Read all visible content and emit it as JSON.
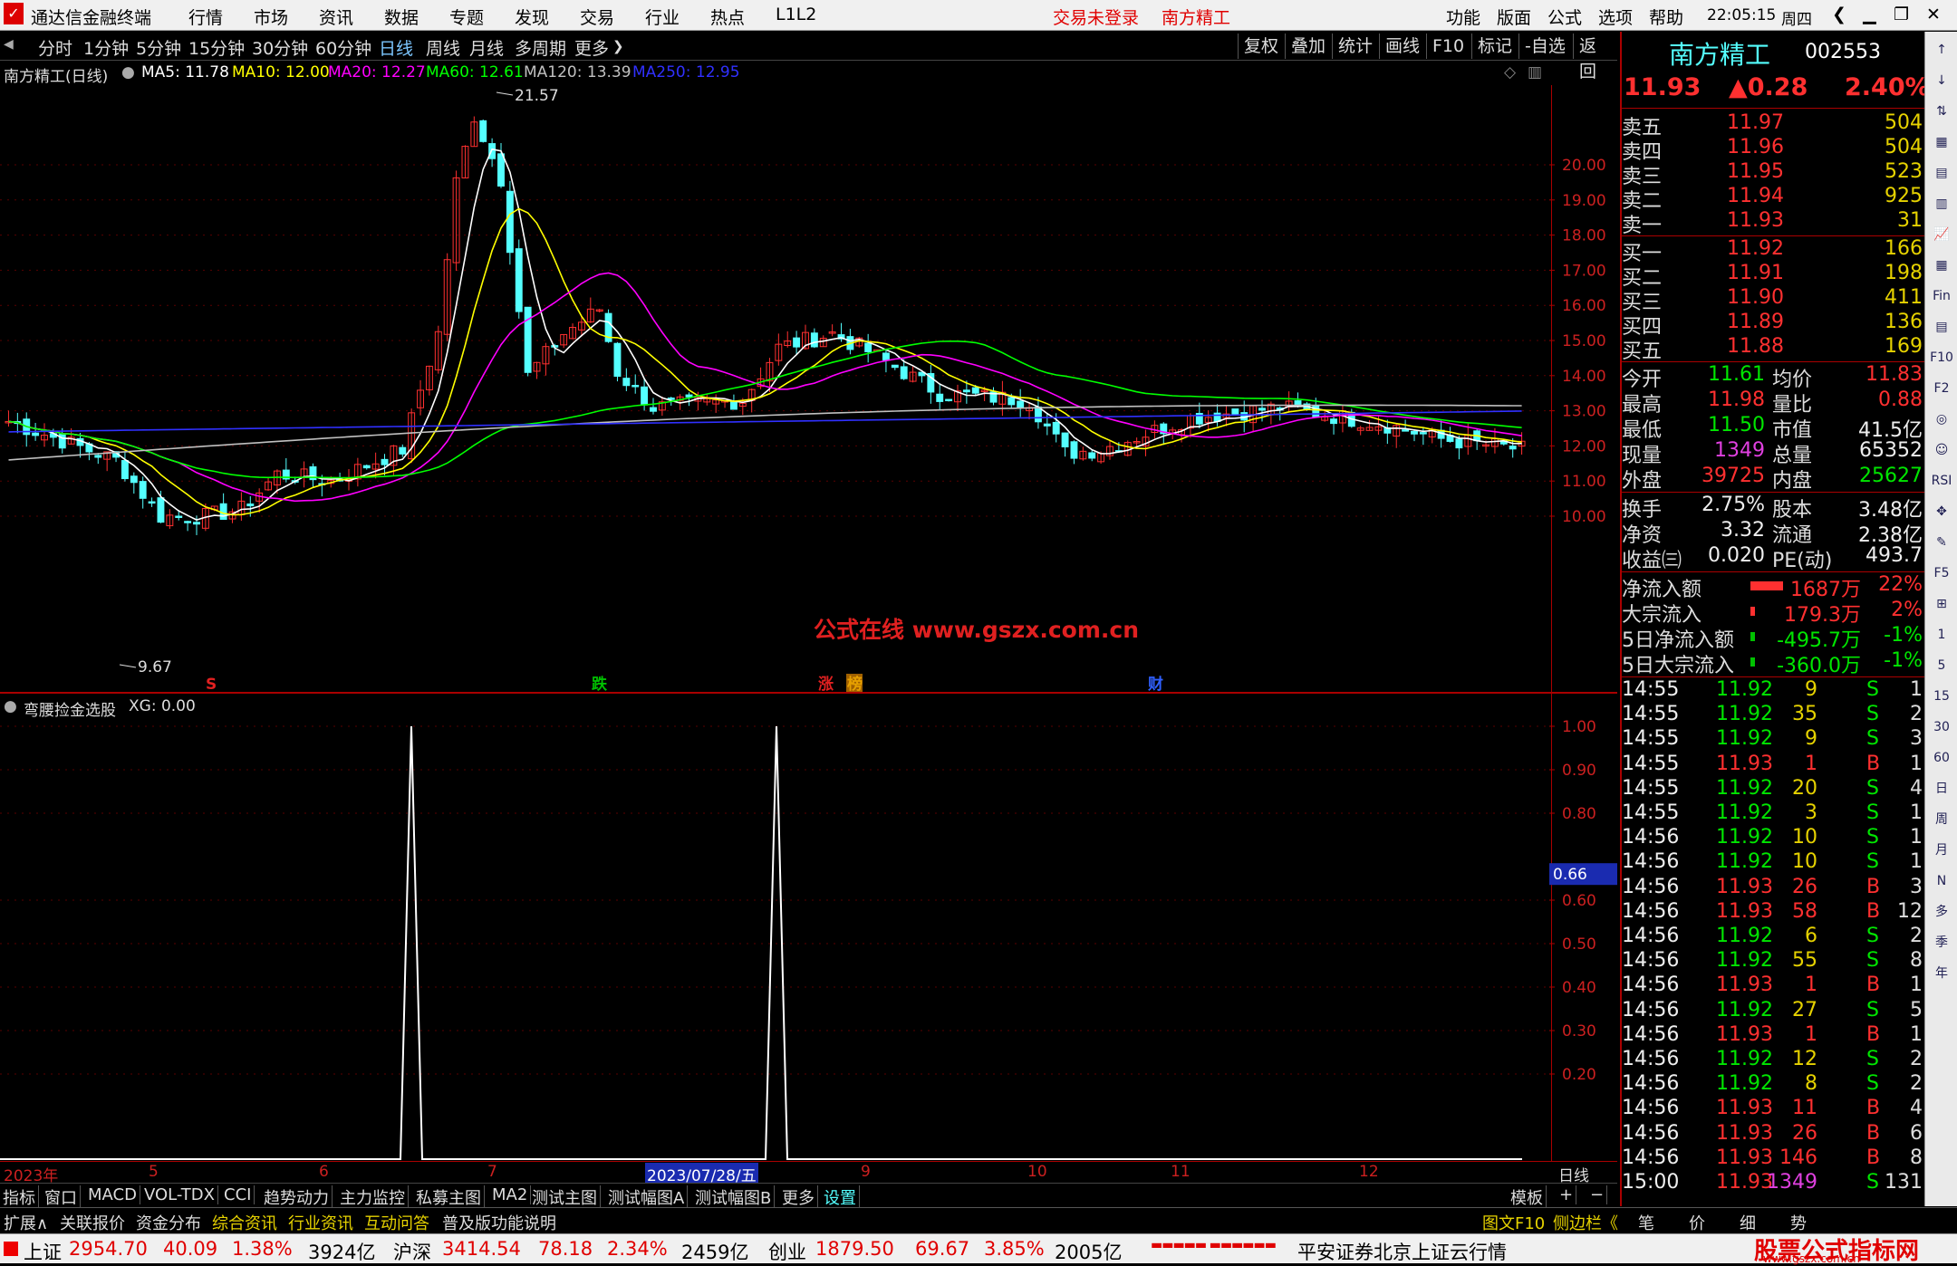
{
  "titlebar": {
    "app_name": "通达信金融终端",
    "menu": [
      "行情",
      "市场",
      "资讯",
      "数据",
      "专题",
      "发现",
      "交易",
      "行业",
      "热点",
      "L1L2"
    ],
    "status_login": "交易未登录",
    "stock_title": "南方精工",
    "right_menu": [
      "功能",
      "版面",
      "公式",
      "选项",
      "帮助"
    ],
    "clock": "22:05:15",
    "weekday": "周四"
  },
  "periods": [
    "分时",
    "1分钟",
    "5分钟",
    "15分钟",
    "30分钟",
    "60分钟",
    "日线",
    "周线",
    "月线",
    "多周期",
    "更多"
  ],
  "period_selected": "日线",
  "toolbar_right": [
    "复权",
    "叠加",
    "统计",
    "画线",
    "F10",
    "标记",
    "-自选",
    "返回"
  ],
  "chart_header": {
    "title": "南方精工(日线)",
    "ma5": "MA5: 11.78",
    "ma10": "MA10: 12.00",
    "ma20": "MA20: 12.27",
    "ma60": "MA60: 12.61",
    "ma120": "MA120: 13.39",
    "ma250": "MA250: 12.95"
  },
  "price_high_label": "21.57",
  "price_low_label": "9.67",
  "price_axis": [
    "20.00",
    "19.00",
    "18.00",
    "17.00",
    "16.00",
    "15.00",
    "14.00",
    "13.00",
    "12.00",
    "11.00",
    "10.00"
  ],
  "watermark": "公式在线  www.gszx.com.cn",
  "event_markers": [
    "S",
    "跌",
    "涨",
    "榜",
    "财"
  ],
  "indicator": {
    "title": "弯腰捡金选股",
    "value": "XG: 0.00",
    "axis": [
      "1.00",
      "0.90",
      "0.80",
      "0.66",
      "0.60",
      "0.50",
      "0.40",
      "0.30",
      "0.20"
    ],
    "current": "0.66"
  },
  "date_axis": [
    "2023年",
    "5",
    "6",
    "7",
    "2023/07/28/五",
    "9",
    "10",
    "11",
    "12"
  ],
  "date_period": "日线",
  "tabs": [
    "指标",
    "窗口",
    "MACD",
    "VOL-TDX",
    "CCI",
    "趋势动力",
    "主力监控",
    "私募主图",
    "MA2",
    "测试主图",
    "测试幅图A",
    "测试幅图B",
    "更多",
    "设置"
  ],
  "tabs_right": [
    "模板",
    "+",
    "−"
  ],
  "bottom_tabs": [
    "扩展∧",
    "关联报价",
    "资金分布",
    "综合资讯",
    "行业资讯",
    "互动问答",
    "普及版功能说明"
  ],
  "bottom_right": [
    "图文F10",
    "侧边栏《",
    "笔",
    "价",
    "细",
    "势"
  ],
  "status": {
    "sh_name": "上证",
    "sh_value": "2954.70",
    "sh_chg": "40.09",
    "sh_pct": "1.38%",
    "sh_amt": "3924亿",
    "hs_name": "沪深",
    "hs_value": "3414.54",
    "hs_chg": "78.18",
    "hs_pct": "2.34%",
    "hs_amt": "2459亿",
    "cy_name": "创业",
    "cy_value": "1879.50",
    "cy_chg": "69.67",
    "cy_pct": "3.85%",
    "cy_amt": "2005亿",
    "broker": "平安证券北京上证云行情",
    "logo_line1": "股票公式指标网",
    "logo_line2": "www.gszx.com.cn"
  },
  "quote": {
    "name": "南方精工",
    "code": "002553",
    "price": "11.93",
    "change": "▲0.28",
    "pct": "2.40%",
    "asks": [
      {
        "label": "卖五",
        "price": "11.97",
        "vol": "504"
      },
      {
        "label": "卖四",
        "price": "11.96",
        "vol": "504"
      },
      {
        "label": "卖三",
        "price": "11.95",
        "vol": "523"
      },
      {
        "label": "卖二",
        "price": "11.94",
        "vol": "925"
      },
      {
        "label": "卖一",
        "price": "11.93",
        "vol": "31"
      }
    ],
    "bids": [
      {
        "label": "买一",
        "price": "11.92",
        "vol": "166"
      },
      {
        "label": "买二",
        "price": "11.91",
        "vol": "198"
      },
      {
        "label": "买三",
        "price": "11.90",
        "vol": "411"
      },
      {
        "label": "买四",
        "price": "11.89",
        "vol": "136"
      },
      {
        "label": "买五",
        "price": "11.88",
        "vol": "169"
      }
    ],
    "stats": [
      [
        "今开",
        "11.61",
        "均价",
        "11.83"
      ],
      [
        "最高",
        "11.98",
        "量比",
        "0.88"
      ],
      [
        "最低",
        "11.50",
        "市值",
        "41.5亿"
      ],
      [
        "现量",
        "1349",
        "总量",
        "65352"
      ],
      [
        "外盘",
        "39725",
        "内盘",
        "25627"
      ]
    ],
    "stats2": [
      [
        "换手",
        "2.75%",
        "股本",
        "3.48亿"
      ],
      [
        "净资",
        "3.32",
        "流通",
        "2.38亿"
      ],
      [
        "收益㈢",
        "0.020",
        "PE(动)",
        "493.7"
      ]
    ],
    "flows": [
      {
        "label": "净流入额",
        "value": "1687万",
        "pct": "22%"
      },
      {
        "label": "大宗流入",
        "value": "179.3万",
        "pct": "2%"
      },
      {
        "label": "5日净流入额",
        "value": "-495.7万",
        "pct": "-1%"
      },
      {
        "label": "5日大宗流入",
        "value": "-360.0万",
        "pct": "-1%"
      }
    ],
    "ticks": [
      [
        "14:55",
        "11.92",
        "9",
        "S",
        "1"
      ],
      [
        "14:55",
        "11.92",
        "35",
        "S",
        "2"
      ],
      [
        "14:55",
        "11.92",
        "9",
        "S",
        "3"
      ],
      [
        "14:55",
        "11.93",
        "1",
        "B",
        "1"
      ],
      [
        "14:55",
        "11.92",
        "20",
        "S",
        "4"
      ],
      [
        "14:55",
        "11.92",
        "3",
        "S",
        "1"
      ],
      [
        "14:56",
        "11.92",
        "10",
        "S",
        "1"
      ],
      [
        "14:56",
        "11.92",
        "10",
        "S",
        "1"
      ],
      [
        "14:56",
        "11.93",
        "26",
        "B",
        "3"
      ],
      [
        "14:56",
        "11.93",
        "58",
        "B",
        "12"
      ],
      [
        "14:56",
        "11.92",
        "6",
        "S",
        "2"
      ],
      [
        "14:56",
        "11.92",
        "55",
        "S",
        "8"
      ],
      [
        "14:56",
        "11.93",
        "1",
        "B",
        "1"
      ],
      [
        "14:56",
        "11.92",
        "27",
        "S",
        "5"
      ],
      [
        "14:56",
        "11.93",
        "1",
        "B",
        "1"
      ],
      [
        "14:56",
        "11.92",
        "12",
        "S",
        "2"
      ],
      [
        "14:56",
        "11.92",
        "8",
        "S",
        "2"
      ],
      [
        "14:56",
        "11.93",
        "11",
        "B",
        "4"
      ],
      [
        "14:56",
        "11.93",
        "26",
        "B",
        "6"
      ],
      [
        "14:56",
        "11.93",
        "146",
        "B",
        "8"
      ],
      [
        "15:00",
        "11.93",
        "1349",
        "S",
        "131"
      ]
    ]
  },
  "sidebar": [
    "↑",
    "↓",
    "⇅",
    "▦",
    "▤",
    "▥",
    "📈",
    "▦",
    "Fin",
    "▤",
    "F10",
    "F2",
    "◎",
    "☺",
    "RSI",
    "✥",
    "✎",
    "F5",
    "⊞",
    "1",
    "5",
    "15",
    "30",
    "60",
    "日",
    "周",
    "月",
    "N",
    "多",
    "季",
    "年"
  ],
  "colors": {
    "up": "#ff3030",
    "down": "#54ffff",
    "ma5": "#ffffff",
    "ma10": "#ffff00",
    "ma20": "#ff00ff",
    "ma60": "#00ff00",
    "ma120": "#c0c0c0",
    "ma250": "#3030ff"
  }
}
